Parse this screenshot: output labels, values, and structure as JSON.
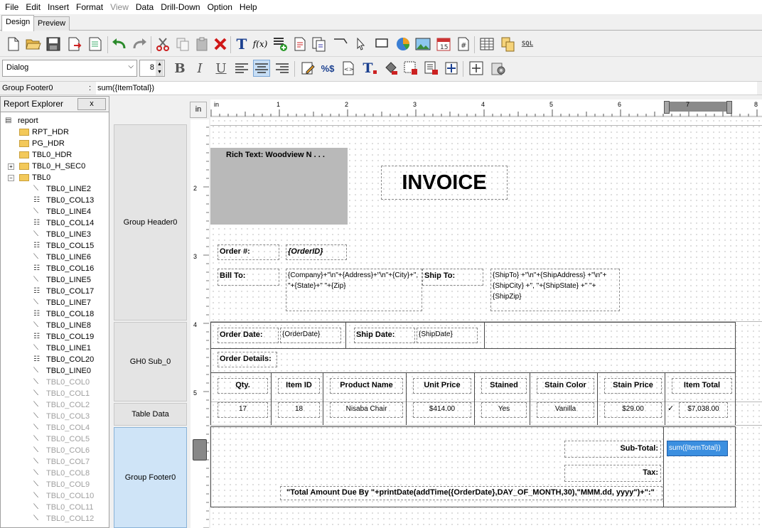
{
  "menu": [
    {
      "label": "File",
      "disabled": false
    },
    {
      "label": "Edit",
      "disabled": false
    },
    {
      "label": "Insert",
      "disabled": false
    },
    {
      "label": "Format",
      "disabled": false
    },
    {
      "label": "View",
      "disabled": true
    },
    {
      "label": "Data",
      "disabled": false
    },
    {
      "label": "Drill-Down",
      "disabled": false
    },
    {
      "label": "Option",
      "disabled": false
    },
    {
      "label": "Help",
      "disabled": false
    }
  ],
  "tabs": {
    "design": "Design",
    "preview": "Preview"
  },
  "toolbar": {
    "font": "Dialog",
    "size": "8",
    "row1_icons": [
      "new-icon",
      "open-icon",
      "save-icon",
      "export-icon",
      "page-setup-icon",
      "undo-icon",
      "redo-icon",
      "cut-icon",
      "copy-icon",
      "paste-icon",
      "delete-icon",
      "text-icon",
      "formula-icon",
      "insert-column-icon",
      "rich-text-icon",
      "sub-report-icon",
      "line-icon",
      "pointer-icon",
      "rectangle-icon",
      "chart-icon",
      "image-icon",
      "date-icon",
      "page-number-icon",
      "table-icon",
      "database-icon",
      "sql-icon"
    ],
    "row2_icons": [
      "bold-icon",
      "italic-icon",
      "underline-icon",
      "align-left-icon",
      "align-center-icon",
      "align-right-icon",
      "edit-icon",
      "format-icon",
      "html-icon",
      "text-color-icon",
      "fill-color-icon",
      "border-icon",
      "properties-icon",
      "move-icon",
      "fit-icon",
      "settings-icon"
    ],
    "sql_label": "SQL"
  },
  "property": {
    "name": "Group Footer0",
    "colon": ":",
    "value": "sum({ItemTotal})"
  },
  "explorer": {
    "title": "Report Explorer",
    "close": "x",
    "items": [
      {
        "label": "report",
        "type": "report",
        "indent": 0,
        "disabled": false
      },
      {
        "label": "RPT_HDR",
        "type": "folder",
        "indent": 1,
        "disabled": false
      },
      {
        "label": "PG_HDR",
        "type": "folder",
        "indent": 1,
        "disabled": false
      },
      {
        "label": "TBL0_HDR",
        "type": "folder",
        "indent": 1,
        "disabled": false
      },
      {
        "label": "TBL0_H_SEC0",
        "type": "folder",
        "indent": 1,
        "disabled": false,
        "expander": "+"
      },
      {
        "label": "TBL0",
        "type": "folder-open",
        "indent": 1,
        "disabled": false,
        "expander": "−"
      },
      {
        "label": "TBL0_LINE2",
        "type": "line",
        "indent": 2,
        "disabled": false
      },
      {
        "label": "TBL0_COL13",
        "type": "col",
        "indent": 2,
        "disabled": false
      },
      {
        "label": "TBL0_LINE4",
        "type": "line",
        "indent": 2,
        "disabled": false
      },
      {
        "label": "TBL0_COL14",
        "type": "col",
        "indent": 2,
        "disabled": false
      },
      {
        "label": "TBL0_LINE3",
        "type": "line",
        "indent": 2,
        "disabled": false
      },
      {
        "label": "TBL0_COL15",
        "type": "col",
        "indent": 2,
        "disabled": false
      },
      {
        "label": "TBL0_LINE6",
        "type": "line",
        "indent": 2,
        "disabled": false
      },
      {
        "label": "TBL0_COL16",
        "type": "col",
        "indent": 2,
        "disabled": false
      },
      {
        "label": "TBL0_LINE5",
        "type": "line",
        "indent": 2,
        "disabled": false
      },
      {
        "label": "TBL0_COL17",
        "type": "col",
        "indent": 2,
        "disabled": false
      },
      {
        "label": "TBL0_LINE7",
        "type": "line",
        "indent": 2,
        "disabled": false
      },
      {
        "label": "TBL0_COL18",
        "type": "col",
        "indent": 2,
        "disabled": false
      },
      {
        "label": "TBL0_LINE8",
        "type": "line",
        "indent": 2,
        "disabled": false
      },
      {
        "label": "TBL0_COL19",
        "type": "col",
        "indent": 2,
        "disabled": false
      },
      {
        "label": "TBL0_LINE1",
        "type": "line",
        "indent": 2,
        "disabled": false
      },
      {
        "label": "TBL0_COL20",
        "type": "col",
        "indent": 2,
        "disabled": false
      },
      {
        "label": "TBL0_LINE0",
        "type": "line",
        "indent": 2,
        "disabled": false
      },
      {
        "label": "TBL0_COL0",
        "type": "line",
        "indent": 2,
        "disabled": true
      },
      {
        "label": "TBL0_COL1",
        "type": "line",
        "indent": 2,
        "disabled": true
      },
      {
        "label": "TBL0_COL2",
        "type": "line",
        "indent": 2,
        "disabled": true
      },
      {
        "label": "TBL0_COL3",
        "type": "line",
        "indent": 2,
        "disabled": true
      },
      {
        "label": "TBL0_COL4",
        "type": "line",
        "indent": 2,
        "disabled": true
      },
      {
        "label": "TBL0_COL5",
        "type": "line",
        "indent": 2,
        "disabled": true
      },
      {
        "label": "TBL0_COL6",
        "type": "line",
        "indent": 2,
        "disabled": true
      },
      {
        "label": "TBL0_COL7",
        "type": "line",
        "indent": 2,
        "disabled": true
      },
      {
        "label": "TBL0_COL8",
        "type": "line",
        "indent": 2,
        "disabled": true
      },
      {
        "label": "TBL0_COL9",
        "type": "line",
        "indent": 2,
        "disabled": true
      },
      {
        "label": "TBL0_COL10",
        "type": "line",
        "indent": 2,
        "disabled": true
      },
      {
        "label": "TBL0_COL11",
        "type": "line",
        "indent": 2,
        "disabled": true
      },
      {
        "label": "TBL0_COL12",
        "type": "line",
        "indent": 2,
        "disabled": true
      }
    ]
  },
  "bands": {
    "in_label": "in",
    "group_header": "Group Header0",
    "gh_sub": "GH0 Sub_0",
    "table_data": "Table Data",
    "group_footer": "Group Footer0"
  },
  "rulers": {
    "h_unit": "in",
    "h_numbers": [
      "1",
      "2",
      "3",
      "4",
      "5",
      "6",
      "7",
      "8"
    ],
    "v_numbers": [
      "2",
      "3",
      "4",
      "5"
    ]
  },
  "report": {
    "rich_text": "Rich Text: Woodview N . . .",
    "title": "INVOICE",
    "order_no_label": "Order #:",
    "order_id": "{OrderID}",
    "bill_to_label": "Bill To:",
    "bill_to_formula": "{Company}+\"\\n\"+{Address}+\"\\n\"+{City}+\", \"+{State}+\" \"+{Zip}",
    "ship_to_label": "Ship To:",
    "ship_to_formula": "{ShipTo} +\"\\n\"+{ShipAddress} +\"\\n\"+{ShipCity} +\", \"+{ShipState} +\" \"+{ShipZip}",
    "order_date_label": "Order Date:",
    "order_date": "{OrderDate}",
    "ship_date_label": "Ship Date:",
    "ship_date": "{ShipDate}",
    "order_details_label": "Order Details:",
    "columns": [
      "Qty.",
      "Item ID",
      "Product Name",
      "Unit Price",
      "Stained",
      "Stain Color",
      "Stain Price",
      "Item Total"
    ],
    "row": [
      "17",
      "18",
      "Nisaba Chair",
      "$414.00",
      "Yes",
      "Vanilla",
      "$29.00",
      "$7,038.00"
    ],
    "row_check": "✓",
    "subtotal_label": "Sub-Total:",
    "subtotal_value": "sum({ItemTotal})",
    "tax_label": "Tax:",
    "total_formula": "\"Total Amount Due By \"+printDate(addTime({OrderDate},DAY_OF_MONTH,30),\"MMM.dd, yyyy\")+\":\""
  }
}
